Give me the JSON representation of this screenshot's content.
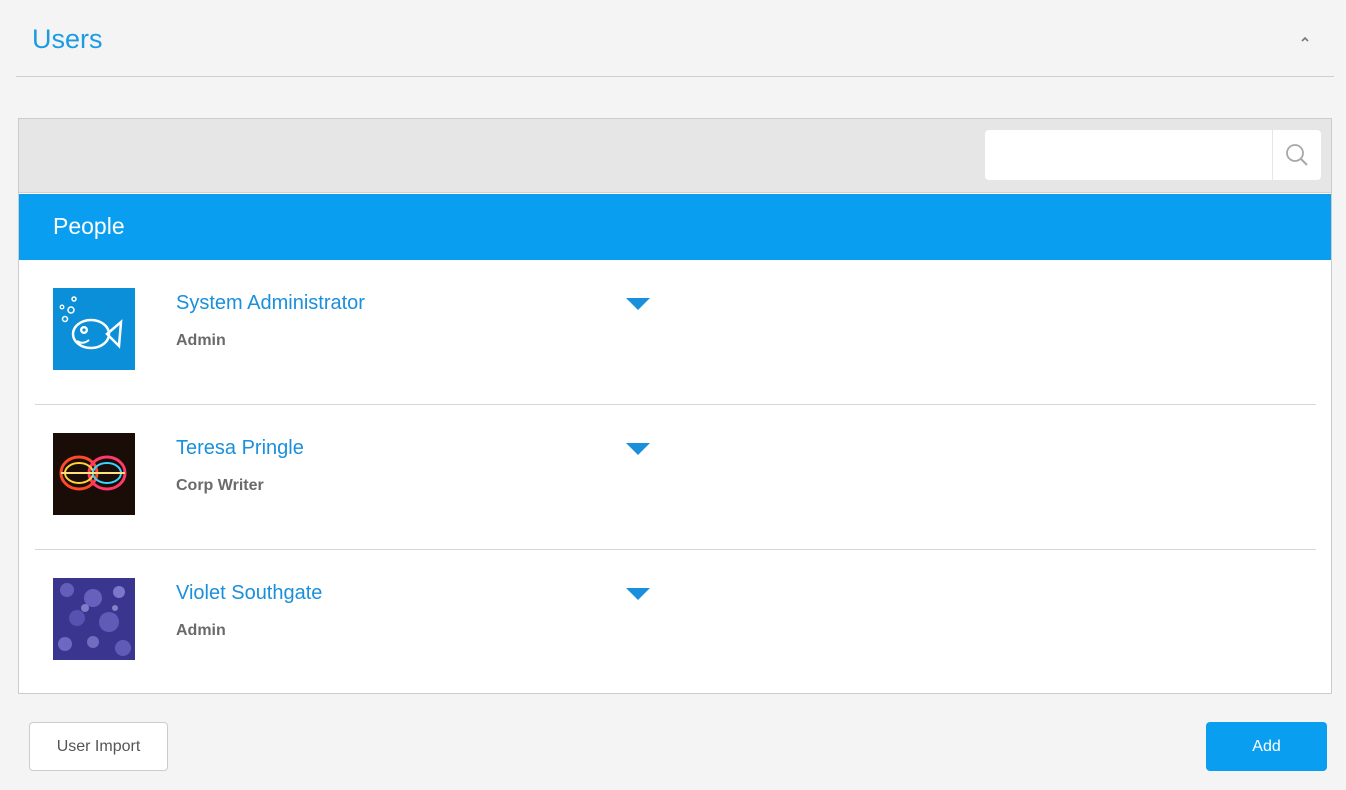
{
  "panel": {
    "title": "Users",
    "collapse_icon": "chevron-up-icon"
  },
  "search": {
    "placeholder": "",
    "value": "",
    "icon": "search-icon"
  },
  "section": {
    "title": "People"
  },
  "users": [
    {
      "name": "System Administrator",
      "role": "Admin",
      "avatar": "fish-avatar",
      "menu_icon": "caret-down-icon"
    },
    {
      "name": "Teresa Pringle",
      "role": "Corp Writer",
      "avatar": "light-trails-avatar",
      "menu_icon": "caret-down-icon"
    },
    {
      "name": "Violet Southgate",
      "role": "Admin",
      "avatar": "bokeh-avatar",
      "menu_icon": "caret-down-icon"
    }
  ],
  "footer": {
    "import_label": "User Import",
    "add_label": "Add"
  },
  "colors": {
    "accent": "#0a9ef0",
    "link": "#1a8fdc",
    "role_text": "#6a6a6a"
  }
}
